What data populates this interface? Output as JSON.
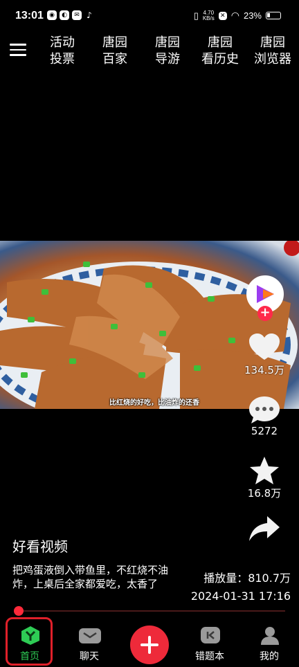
{
  "status_bar": {
    "time": "13:01",
    "net_speed_value": "4.70",
    "net_speed_unit": "KB/s",
    "battery": "23%"
  },
  "top_nav": {
    "tabs": [
      {
        "line1": "活动",
        "line2": "投票"
      },
      {
        "line1": "唐园",
        "line2": "百家"
      },
      {
        "line1": "唐园",
        "line2": "导游"
      },
      {
        "line1": "唐园",
        "line2": "看历史"
      },
      {
        "line1": "唐园",
        "line2": "浏览器"
      }
    ]
  },
  "video": {
    "caption": "比红烧的好吃，比油炸的还香"
  },
  "actions": {
    "likes": "134.5万",
    "comments": "5272",
    "favorites": "16.8万"
  },
  "info": {
    "source": "好看视频",
    "description": "把鸡蛋液倒入带鱼里，不红烧不油炸，上桌后全家都爱吃，太香了",
    "plays": "播放量：810.7万",
    "date": "2024-01-31 17:16"
  },
  "bottom_nav": {
    "home": "首页",
    "chat": "聊天",
    "wrong_book": "错题本",
    "mine": "我的"
  },
  "colors": {
    "accent_red": "#ee2a3a",
    "active_green": "#2ecc55"
  }
}
